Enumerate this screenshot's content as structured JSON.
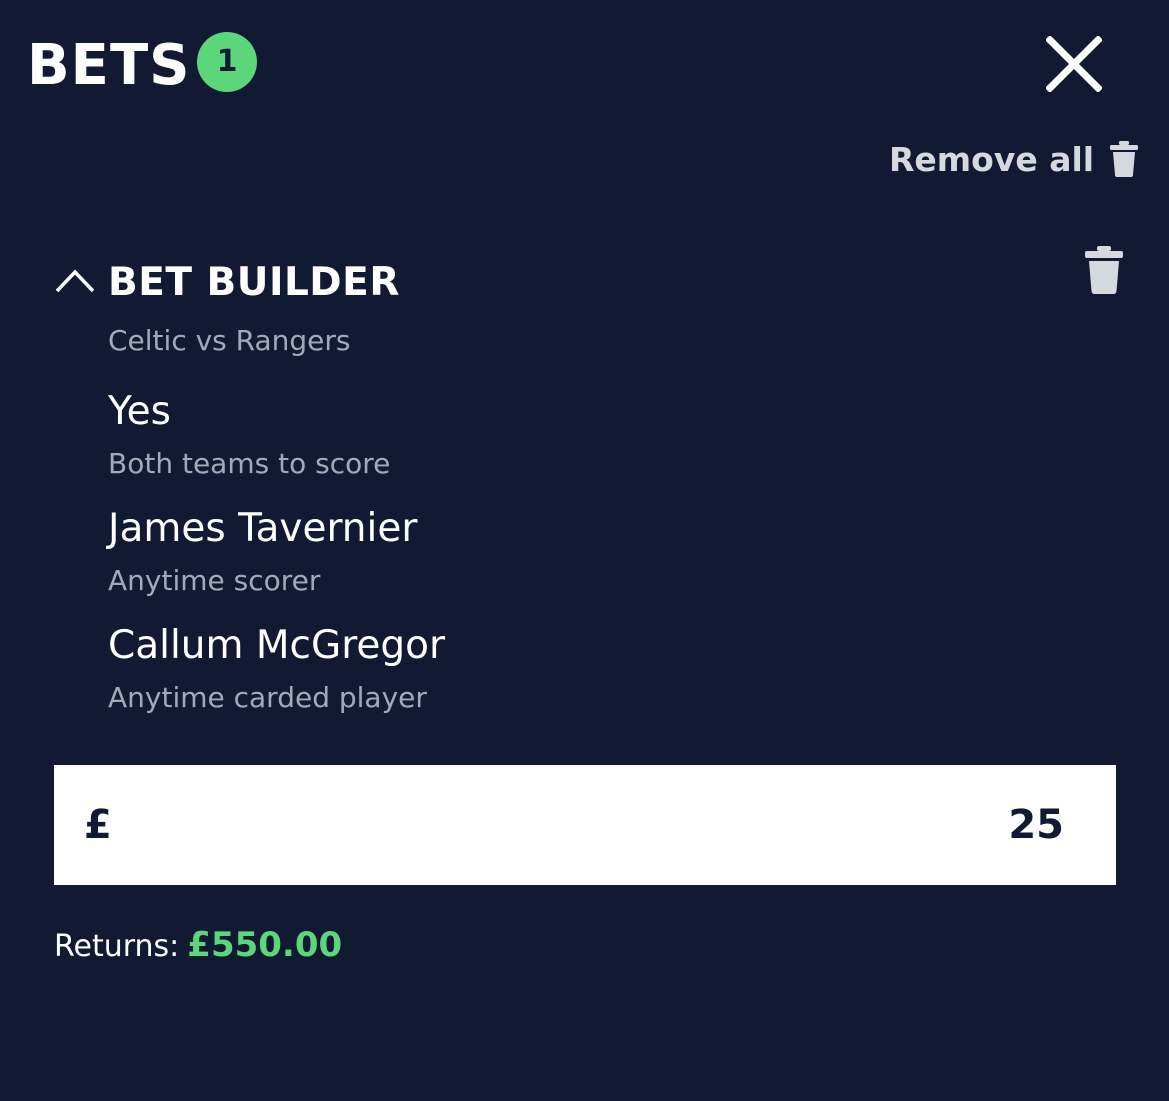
{
  "header": {
    "title": "BETS",
    "bet_count": "1"
  },
  "remove_all_label": "Remove all",
  "bet": {
    "title": "BET BUILDER",
    "event": "Celtic vs Rangers",
    "selections": [
      {
        "name": "Yes",
        "market": "Both teams to score"
      },
      {
        "name": "James Tavernier",
        "market": "Anytime scorer"
      },
      {
        "name": "Callum McGregor",
        "market": "Anytime carded player"
      }
    ]
  },
  "stake": {
    "currency": "£",
    "value": "25"
  },
  "returns": {
    "label": "Returns:",
    "value": "£550.00"
  },
  "colors": {
    "background": "#121a33",
    "accent_green": "#5cd67b",
    "muted_text": "#a4a8b8",
    "icon_grey": "#d6d8e0"
  },
  "icons": {
    "close": "close-icon",
    "trash": "trash-icon",
    "chevron": "chevron-up-icon"
  }
}
